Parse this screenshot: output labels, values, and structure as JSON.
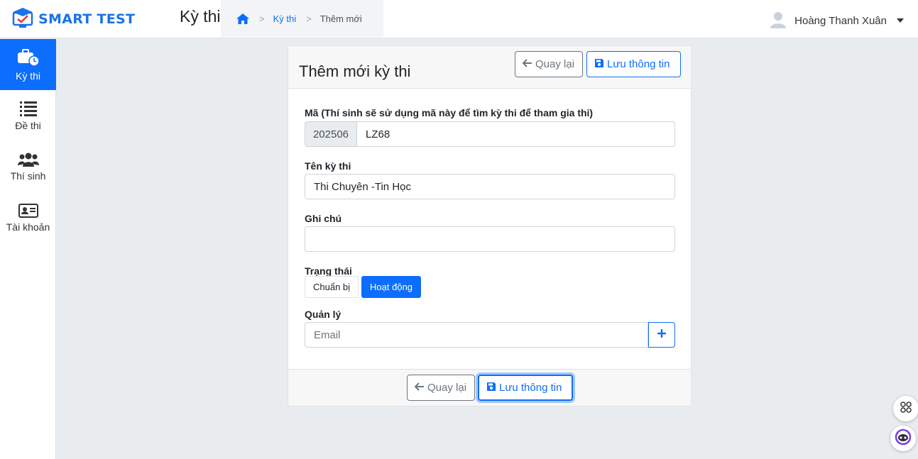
{
  "app": {
    "logo_text": "SMART TEST",
    "page_title": "Kỳ thi"
  },
  "breadcrumb": {
    "home_icon": "home-icon",
    "items": [
      "Kỳ thi",
      "Thêm mới"
    ]
  },
  "user": {
    "name": "Hoàng Thanh Xuân"
  },
  "sidebar": {
    "items": [
      {
        "label": "Kỳ thi",
        "icon": "briefcase-clock-icon",
        "active": true
      },
      {
        "label": "Đề thi",
        "icon": "list-icon",
        "active": false
      },
      {
        "label": "Thí sinh",
        "icon": "users-icon",
        "active": false
      },
      {
        "label": "Tài khoản",
        "icon": "id-card-icon",
        "active": false
      }
    ]
  },
  "form": {
    "title": "Thêm mới kỳ thi",
    "back_label": "Quay lại",
    "save_label": "Lưu thông tin",
    "code": {
      "label": "Mã (Thí sinh sẽ sử dụng mã này để tìm kỳ thi để tham gia thi)",
      "prefix": "202506",
      "value": "LZ68"
    },
    "name": {
      "label": "Tên kỳ thi",
      "value": "Thi Chuyên -Tin Học"
    },
    "note": {
      "label": "Ghi chú",
      "value": ""
    },
    "status": {
      "label": "Trạng thái",
      "options": [
        "Chuẩn bị",
        "Hoạt động"
      ],
      "selected": "Hoạt động"
    },
    "manager": {
      "label": "Quản lý",
      "placeholder": "Email",
      "add_icon": "plus-icon"
    }
  },
  "colors": {
    "primary": "#0d6efd",
    "secondary": "#6c757d",
    "background": "#e9ecef"
  }
}
